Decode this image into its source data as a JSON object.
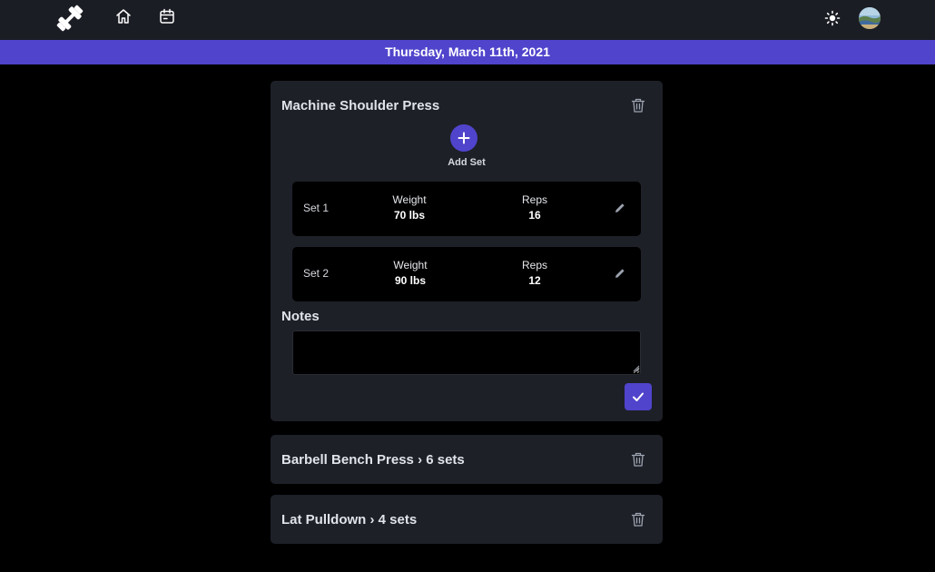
{
  "header": {
    "logo_icon": "dumbbell-icon",
    "nav": [
      {
        "icon": "home-icon"
      },
      {
        "icon": "calendar-icon"
      }
    ],
    "theme_icon": "sun-icon",
    "avatar_icon": "user-avatar"
  },
  "date_bar": {
    "text": "Thursday, March 11th, 2021",
    "color": "#5044cc"
  },
  "exercises": [
    {
      "title": "Machine Shoulder Press",
      "expanded": true,
      "add_set_label": "Add Set",
      "sets": [
        {
          "name": "Set 1",
          "weight_label": "Weight",
          "weight": "70 lbs",
          "reps_label": "Reps",
          "reps": "16"
        },
        {
          "name": "Set 2",
          "weight_label": "Weight",
          "weight": "90 lbs",
          "reps_label": "Reps",
          "reps": "12"
        }
      ],
      "notes_title": "Notes",
      "notes_value": ""
    },
    {
      "title": "Barbell Bench Press › 6 sets",
      "expanded": false
    },
    {
      "title": "Lat Pulldown › 4 sets",
      "expanded": false
    }
  ],
  "colors": {
    "accent": "#5044cc",
    "background": "#000000",
    "card": "#1e2028",
    "topbar": "#1b1d24"
  }
}
